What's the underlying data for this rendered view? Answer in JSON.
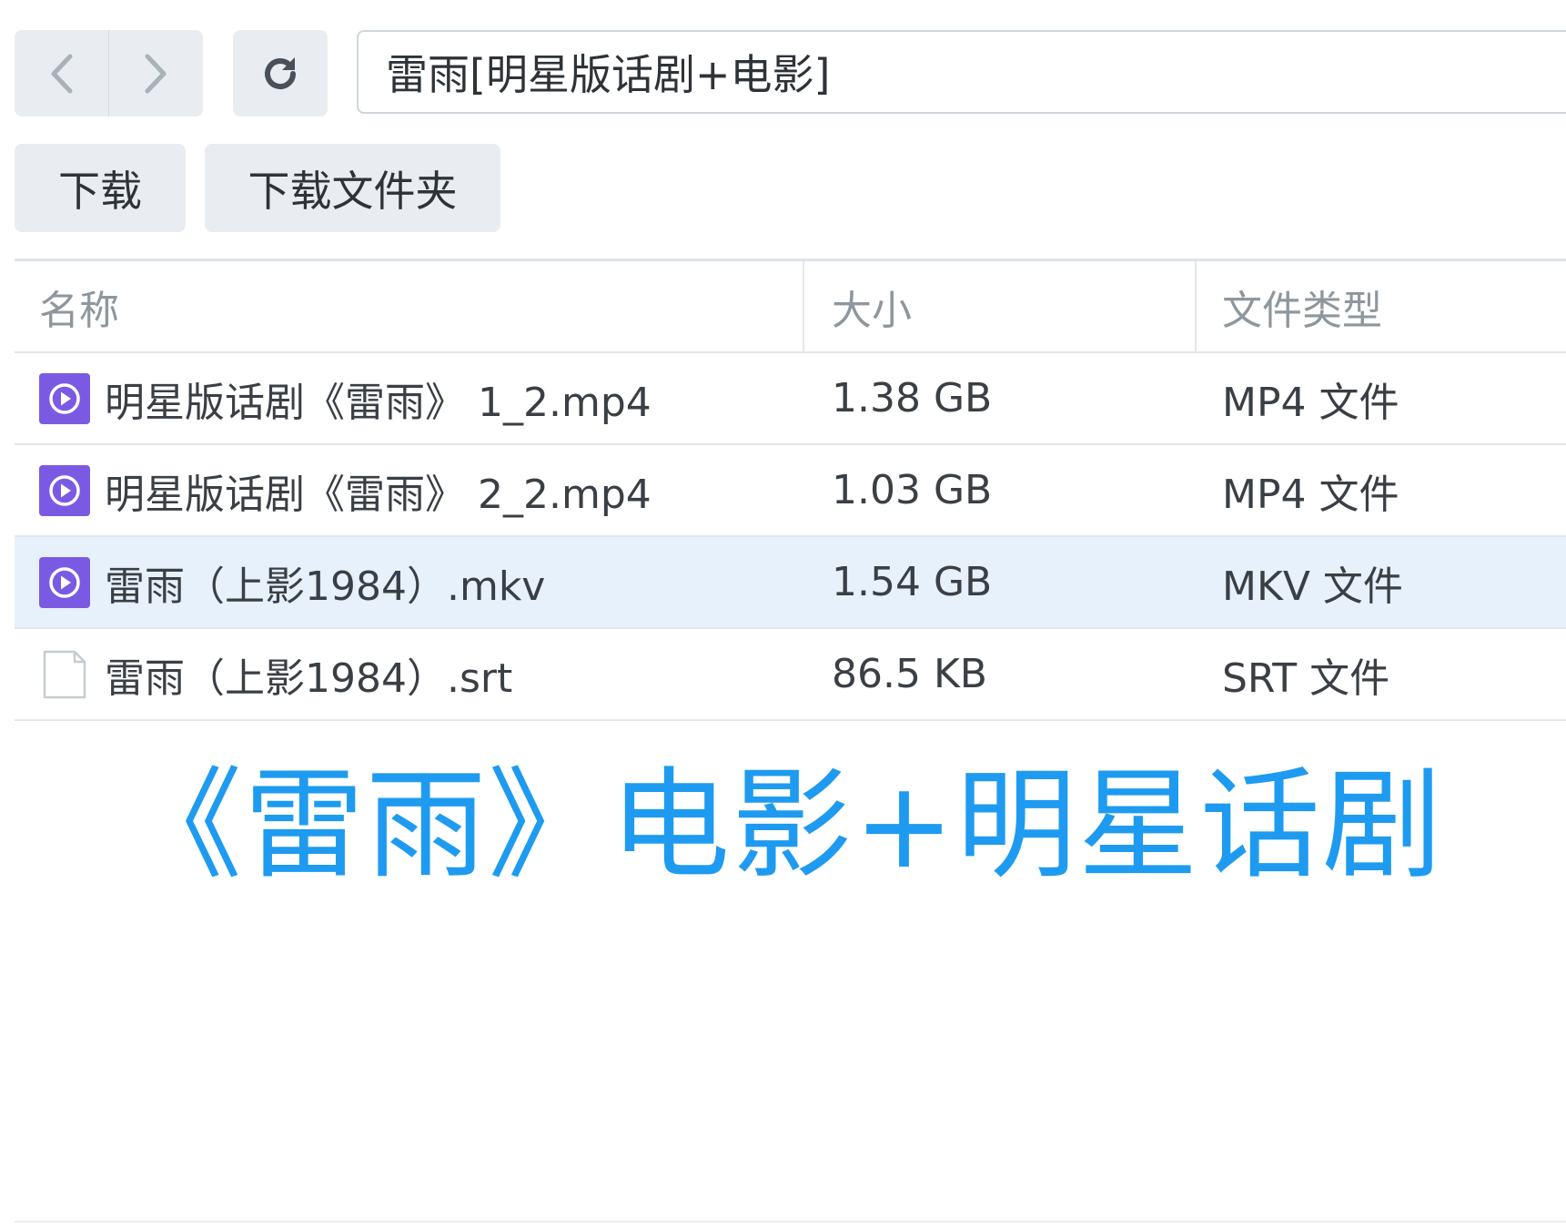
{
  "address_bar": {
    "path": "雷雨[明星版话剧+电影]"
  },
  "toolbar": {
    "download_label": "下载",
    "download_folder_label": "下载文件夹"
  },
  "table": {
    "headers": {
      "name": "名称",
      "size": "大小",
      "type": "文件类型"
    },
    "rows": [
      {
        "name": "明星版话剧《雷雨》 1_2.mp4",
        "size": "1.38 GB",
        "type": "MP4 文件",
        "icon": "video-file-icon",
        "selected": false
      },
      {
        "name": "明星版话剧《雷雨》 2_2.mp4",
        "size": "1.03 GB",
        "type": "MP4 文件",
        "icon": "video-file-icon",
        "selected": false
      },
      {
        "name": "雷雨（上影1984）.mkv",
        "size": "1.54 GB",
        "type": "MKV 文件",
        "icon": "video-file-icon",
        "selected": true
      },
      {
        "name": "雷雨（上影1984）.srt",
        "size": "86.5 KB",
        "type": "SRT 文件",
        "icon": "document-file-icon",
        "selected": false
      }
    ]
  },
  "banner": {
    "text": "《雷雨》电影+明星话剧"
  },
  "colors": {
    "accent": "#1e9bf0",
    "video_icon": "#7b5ae3",
    "selected_row": "#e6f1fb",
    "button_bg": "#e9edf1"
  }
}
